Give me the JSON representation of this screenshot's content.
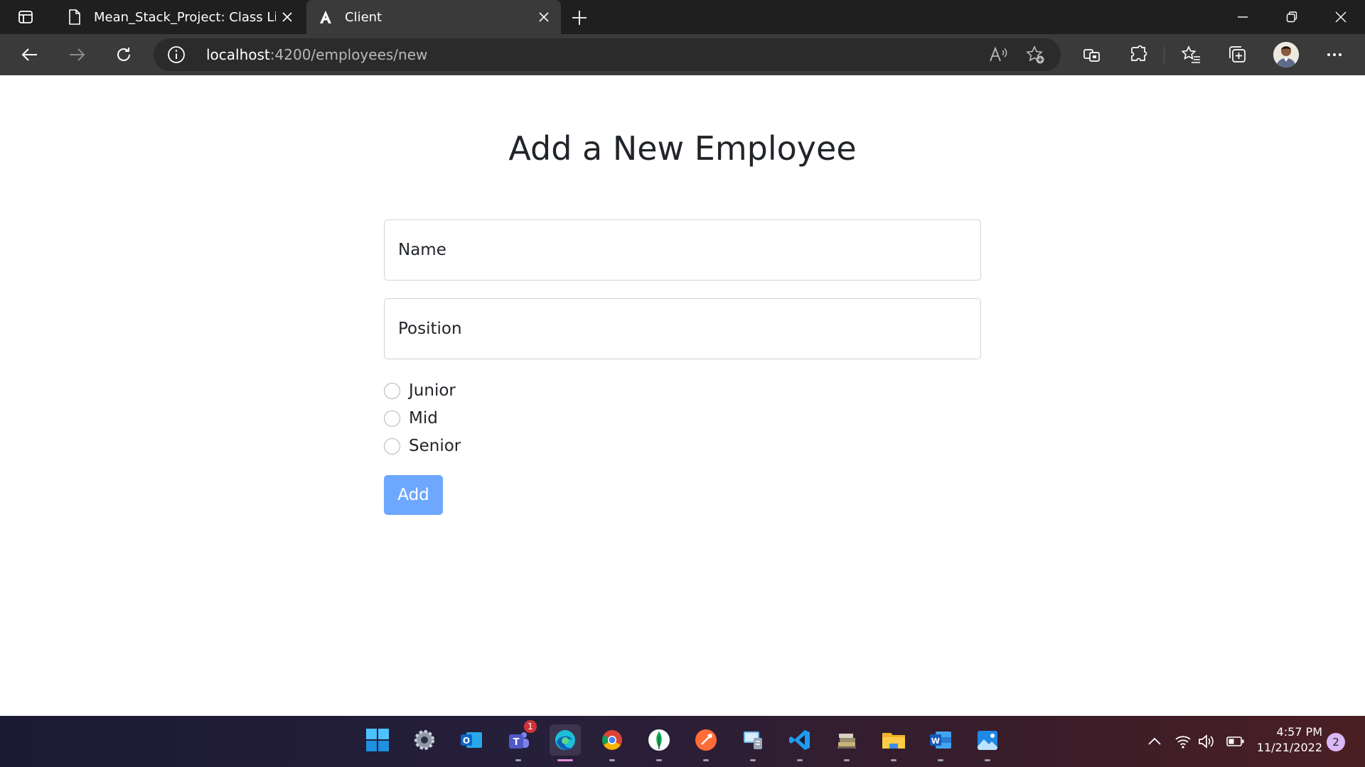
{
  "browser": {
    "tabs": [
      {
        "title": "Mean_Stack_Project: Class List",
        "icon": "page-icon",
        "active": false
      },
      {
        "title": "Client",
        "icon": "angular-icon",
        "active": true
      }
    ],
    "address": {
      "host": "localhost",
      "path": ":4200/employees/new"
    }
  },
  "form": {
    "title": "Add a New Employee",
    "name_placeholder": "Name",
    "position_placeholder": "Position",
    "levels": [
      "Junior",
      "Mid",
      "Senior"
    ],
    "submit_label": "Add"
  },
  "taskbar": {
    "apps": [
      "windows-start",
      "settings",
      "outlook",
      "teams",
      "edge",
      "chrome",
      "mongodb-compass",
      "postman",
      "server-manager",
      "vscode",
      "python-stack",
      "file-explorer",
      "word",
      "photos"
    ],
    "teams_badge": "1",
    "time": "4:57 PM",
    "date": "11/21/2022",
    "notifications": "2"
  },
  "colors": {
    "accent": "#6ea8fe",
    "text": "#212529",
    "border": "#ced4da",
    "chrome_dark": "#1f1f1f",
    "chrome_toolbar": "#3a3a3a"
  }
}
